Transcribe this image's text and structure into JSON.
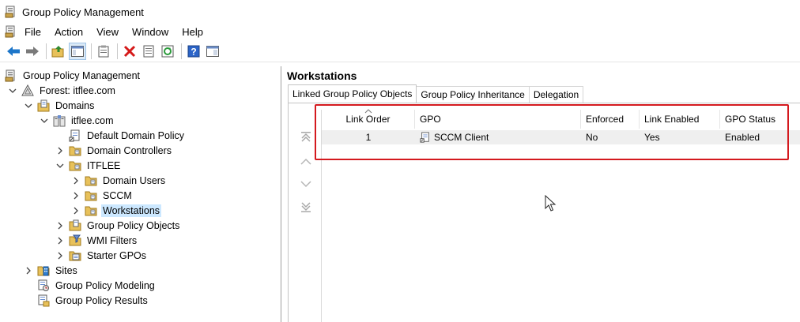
{
  "window": {
    "title": "Group Policy Management"
  },
  "menu": {
    "items": [
      "File",
      "Action",
      "View",
      "Window",
      "Help"
    ]
  },
  "tree": {
    "root": "Group Policy Management",
    "forest": "Forest: itflee.com",
    "domains": "Domains",
    "domain": "itflee.com",
    "default_policy": "Default Domain Policy",
    "domain_controllers": "Domain Controllers",
    "ou_itflee": "ITFLEE",
    "domain_users": "Domain Users",
    "sccm": "SCCM",
    "workstations": "Workstations",
    "gpo_objects": "Group Policy Objects",
    "wmi_filters": "WMI Filters",
    "starter_gpos": "Starter GPOs",
    "sites": "Sites",
    "modeling": "Group Policy Modeling",
    "results": "Group Policy Results"
  },
  "content": {
    "title": "Workstations",
    "tabs": [
      "Linked Group Policy Objects",
      "Group Policy Inheritance",
      "Delegation"
    ],
    "columns": [
      "Link Order",
      "GPO",
      "Enforced",
      "Link Enabled",
      "GPO Status"
    ],
    "rows": [
      {
        "link_order": "1",
        "gpo": "SCCM Client",
        "enforced": "No",
        "link_enabled": "Yes",
        "gpo_status": "Enabled"
      }
    ]
  },
  "colors": {
    "highlight": "#d4191e",
    "selection": "#cce8ff",
    "row_bg": "#efefef"
  },
  "icons": [
    "gpm-icon",
    "back-arrow-icon",
    "forward-arrow-icon",
    "up-folder-icon",
    "show-hide-tree-icon",
    "clipboard-icon",
    "delete-icon",
    "properties-icon",
    "refresh-icon",
    "help-icon",
    "console-icon"
  ]
}
